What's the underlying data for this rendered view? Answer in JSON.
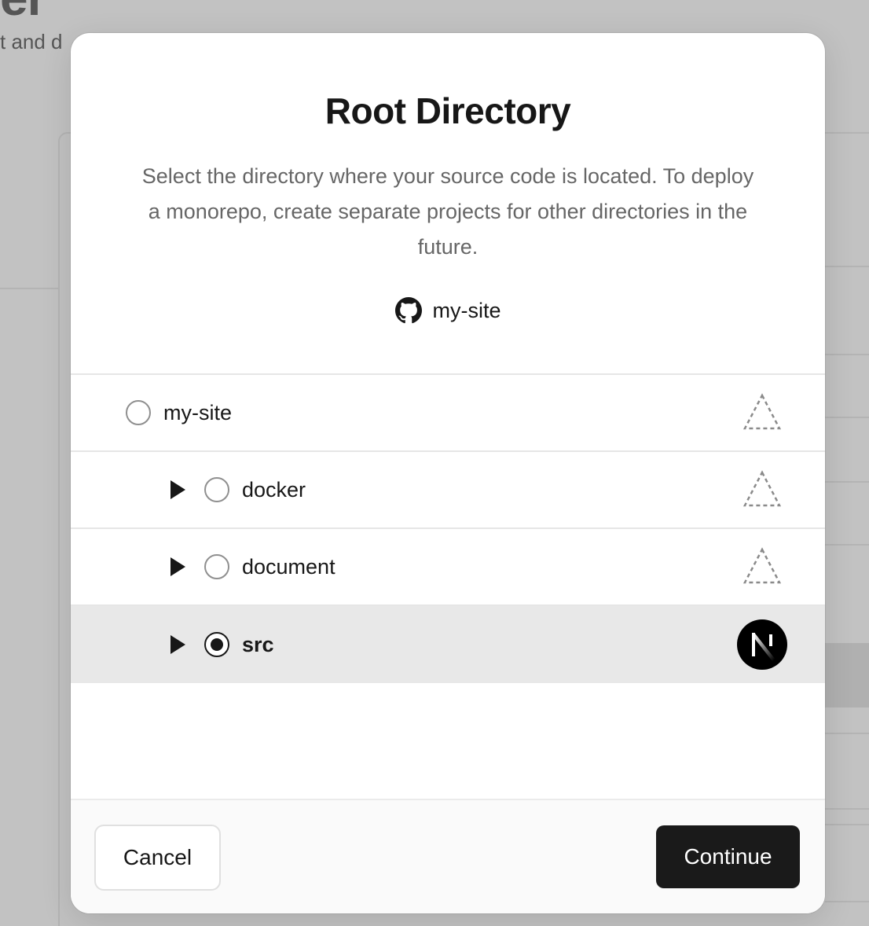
{
  "background": {
    "heading_fragment": "er",
    "subtitle_fragment": "t and d"
  },
  "modal": {
    "title": "Root Directory",
    "description": "Select the directory where your source code is located. To deploy a monorepo, create separate projects for other directories in the future.",
    "repository": {
      "icon": "github-icon",
      "name": "my-site"
    },
    "directories": [
      {
        "name": "my-site",
        "expandable": false,
        "selected": false,
        "framework_icon": "dashed-triangle-icon"
      },
      {
        "name": "docker",
        "expandable": true,
        "selected": false,
        "framework_icon": "dashed-triangle-icon"
      },
      {
        "name": "document",
        "expandable": true,
        "selected": false,
        "framework_icon": "dashed-triangle-icon"
      },
      {
        "name": "src",
        "expandable": true,
        "selected": true,
        "framework_icon": "nextjs-icon"
      }
    ],
    "footer": {
      "cancel_label": "Cancel",
      "continue_label": "Continue"
    }
  },
  "colors": {
    "overlay": "#c2c2c2",
    "primary_button": "#1a1a1a",
    "selected_row": "#e8e8e8"
  }
}
